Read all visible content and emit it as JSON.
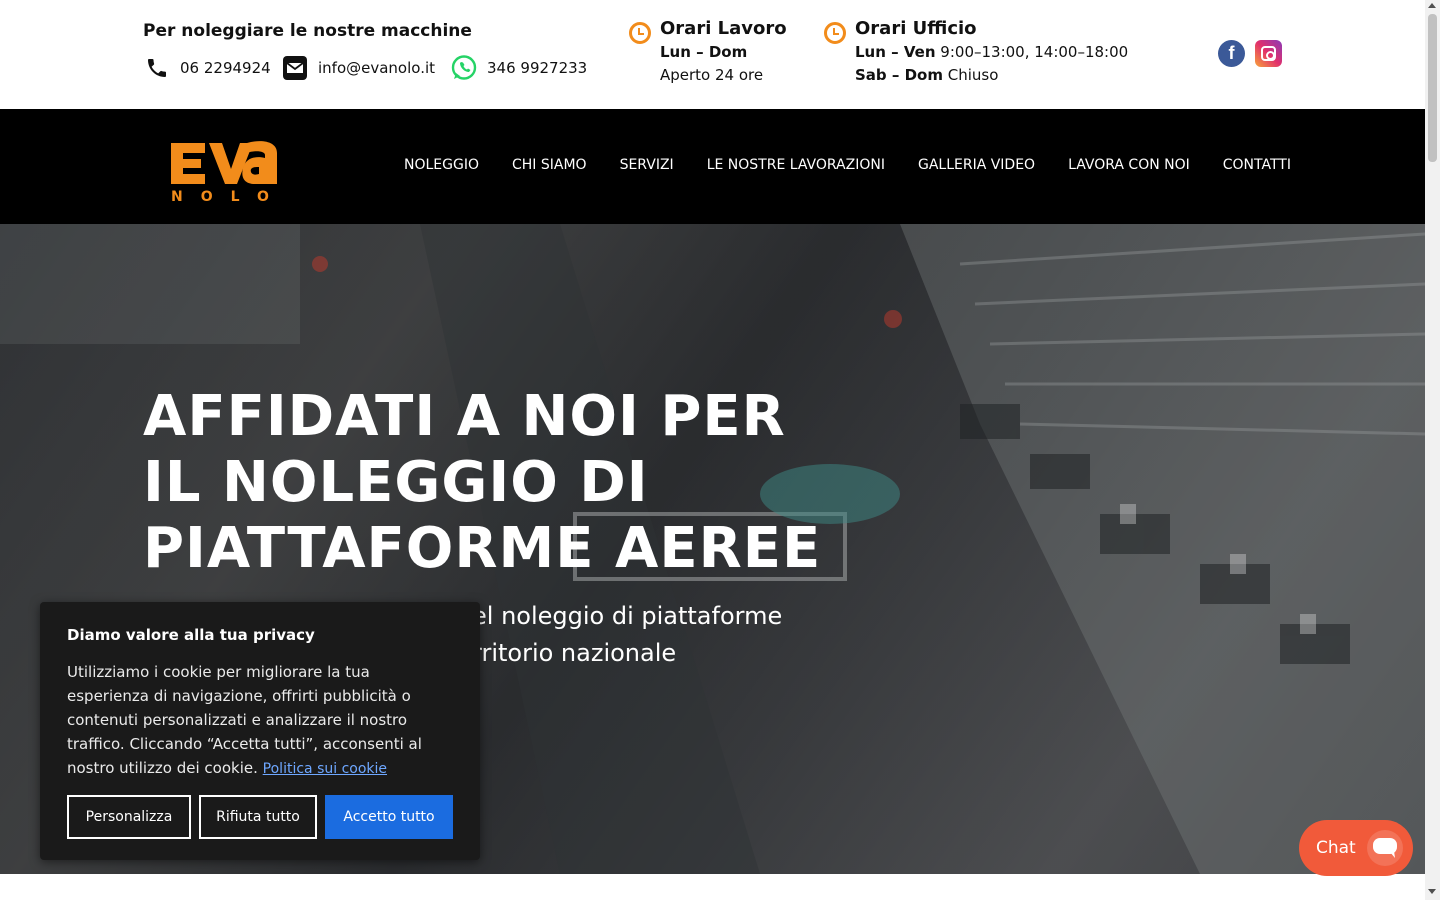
{
  "topbar": {
    "title": "Per noleggiare le nostre macchine",
    "phone": "06 2294924",
    "email": "info@evanolo.it",
    "whatsapp": "346 9927233",
    "work_hours": {
      "title": "Orari Lavoro",
      "days": "Lun – Dom",
      "status": "Aperto 24 ore"
    },
    "office_hours": {
      "title": "Orari Ufficio",
      "weekday_days": "Lun – Ven",
      "weekday_time": "9:00–13:00, 14:00–18:00",
      "weekend_days": "Sab – Dom",
      "weekend_status": "Chiuso"
    },
    "social": [
      "facebook-icon",
      "instagram-icon"
    ],
    "accent_color": "#f28c1b"
  },
  "nav": {
    "logo": {
      "top": "EVA",
      "bottom": "NOLO",
      "color": "#f28c1b"
    },
    "items": [
      {
        "label": "NOLEGGIO"
      },
      {
        "label": "CHI SIAMO"
      },
      {
        "label": "SERVIZI"
      },
      {
        "label": "LE NOSTRE LAVORAZIONI"
      },
      {
        "label": "GALLERIA VIDEO"
      },
      {
        "label": "LAVORA CON NOI"
      },
      {
        "label": "CONTATTI"
      }
    ]
  },
  "hero": {
    "title": "AFFIDATI A NOI PER IL NOLEGGIO DI PIATTAFORME AEREE",
    "subtitle_visible": "el noleggio di piattaforme\nrritorio nazionale"
  },
  "cookie": {
    "title": "Diamo valore alla tua privacy",
    "text": "Utilizziamo i cookie per migliorare la tua esperienza di navigazione, offrirti pubblicità o contenuti personalizzati e analizzare il nostro traffico. Cliccando “Accetta tutti”, acconsenti al nostro utilizzo dei cookie.",
    "link": "Politica sui cookie",
    "buttons": {
      "customize": "Personalizza",
      "reject": "Rifiuta tutto",
      "accept": "Accetto tutto"
    },
    "accept_color": "#1b6ce0"
  },
  "chat": {
    "label": "Chat",
    "color": "#f15a3a"
  }
}
